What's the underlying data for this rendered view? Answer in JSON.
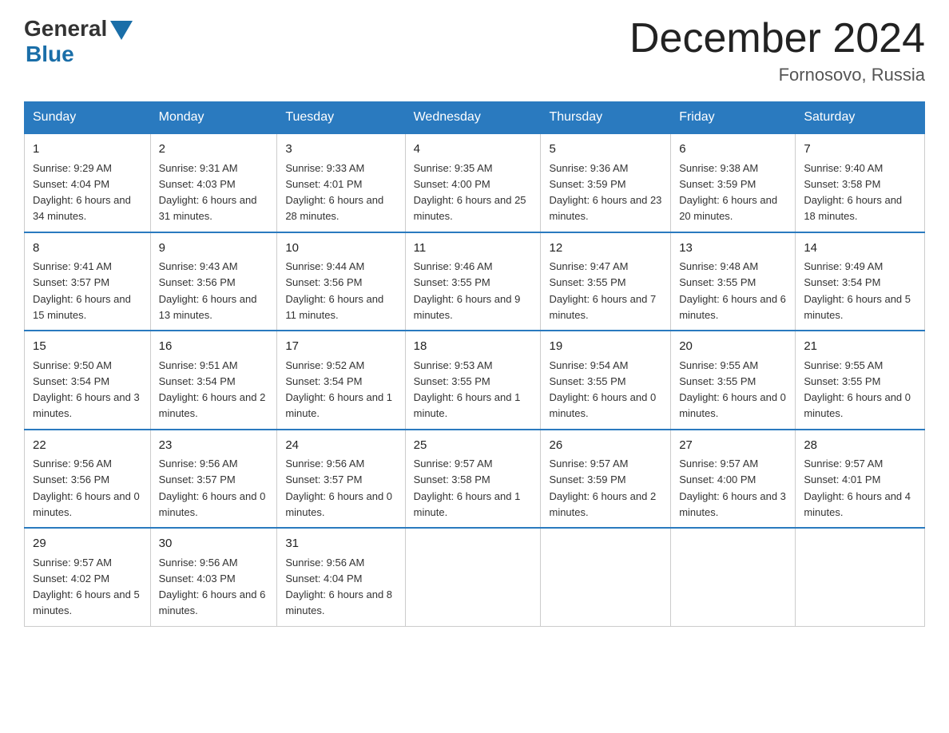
{
  "header": {
    "logo_general": "General",
    "logo_blue": "Blue",
    "main_title": "December 2024",
    "subtitle": "Fornosovo, Russia"
  },
  "days_of_week": [
    "Sunday",
    "Monday",
    "Tuesday",
    "Wednesday",
    "Thursday",
    "Friday",
    "Saturday"
  ],
  "weeks": [
    [
      {
        "day": 1,
        "sunrise": "9:29 AM",
        "sunset": "4:04 PM",
        "daylight": "6 hours and 34 minutes."
      },
      {
        "day": 2,
        "sunrise": "9:31 AM",
        "sunset": "4:03 PM",
        "daylight": "6 hours and 31 minutes."
      },
      {
        "day": 3,
        "sunrise": "9:33 AM",
        "sunset": "4:01 PM",
        "daylight": "6 hours and 28 minutes."
      },
      {
        "day": 4,
        "sunrise": "9:35 AM",
        "sunset": "4:00 PM",
        "daylight": "6 hours and 25 minutes."
      },
      {
        "day": 5,
        "sunrise": "9:36 AM",
        "sunset": "3:59 PM",
        "daylight": "6 hours and 23 minutes."
      },
      {
        "day": 6,
        "sunrise": "9:38 AM",
        "sunset": "3:59 PM",
        "daylight": "6 hours and 20 minutes."
      },
      {
        "day": 7,
        "sunrise": "9:40 AM",
        "sunset": "3:58 PM",
        "daylight": "6 hours and 18 minutes."
      }
    ],
    [
      {
        "day": 8,
        "sunrise": "9:41 AM",
        "sunset": "3:57 PM",
        "daylight": "6 hours and 15 minutes."
      },
      {
        "day": 9,
        "sunrise": "9:43 AM",
        "sunset": "3:56 PM",
        "daylight": "6 hours and 13 minutes."
      },
      {
        "day": 10,
        "sunrise": "9:44 AM",
        "sunset": "3:56 PM",
        "daylight": "6 hours and 11 minutes."
      },
      {
        "day": 11,
        "sunrise": "9:46 AM",
        "sunset": "3:55 PM",
        "daylight": "6 hours and 9 minutes."
      },
      {
        "day": 12,
        "sunrise": "9:47 AM",
        "sunset": "3:55 PM",
        "daylight": "6 hours and 7 minutes."
      },
      {
        "day": 13,
        "sunrise": "9:48 AM",
        "sunset": "3:55 PM",
        "daylight": "6 hours and 6 minutes."
      },
      {
        "day": 14,
        "sunrise": "9:49 AM",
        "sunset": "3:54 PM",
        "daylight": "6 hours and 5 minutes."
      }
    ],
    [
      {
        "day": 15,
        "sunrise": "9:50 AM",
        "sunset": "3:54 PM",
        "daylight": "6 hours and 3 minutes."
      },
      {
        "day": 16,
        "sunrise": "9:51 AM",
        "sunset": "3:54 PM",
        "daylight": "6 hours and 2 minutes."
      },
      {
        "day": 17,
        "sunrise": "9:52 AM",
        "sunset": "3:54 PM",
        "daylight": "6 hours and 1 minute."
      },
      {
        "day": 18,
        "sunrise": "9:53 AM",
        "sunset": "3:55 PM",
        "daylight": "6 hours and 1 minute."
      },
      {
        "day": 19,
        "sunrise": "9:54 AM",
        "sunset": "3:55 PM",
        "daylight": "6 hours and 0 minutes."
      },
      {
        "day": 20,
        "sunrise": "9:55 AM",
        "sunset": "3:55 PM",
        "daylight": "6 hours and 0 minutes."
      },
      {
        "day": 21,
        "sunrise": "9:55 AM",
        "sunset": "3:55 PM",
        "daylight": "6 hours and 0 minutes."
      }
    ],
    [
      {
        "day": 22,
        "sunrise": "9:56 AM",
        "sunset": "3:56 PM",
        "daylight": "6 hours and 0 minutes."
      },
      {
        "day": 23,
        "sunrise": "9:56 AM",
        "sunset": "3:57 PM",
        "daylight": "6 hours and 0 minutes."
      },
      {
        "day": 24,
        "sunrise": "9:56 AM",
        "sunset": "3:57 PM",
        "daylight": "6 hours and 0 minutes."
      },
      {
        "day": 25,
        "sunrise": "9:57 AM",
        "sunset": "3:58 PM",
        "daylight": "6 hours and 1 minute."
      },
      {
        "day": 26,
        "sunrise": "9:57 AM",
        "sunset": "3:59 PM",
        "daylight": "6 hours and 2 minutes."
      },
      {
        "day": 27,
        "sunrise": "9:57 AM",
        "sunset": "4:00 PM",
        "daylight": "6 hours and 3 minutes."
      },
      {
        "day": 28,
        "sunrise": "9:57 AM",
        "sunset": "4:01 PM",
        "daylight": "6 hours and 4 minutes."
      }
    ],
    [
      {
        "day": 29,
        "sunrise": "9:57 AM",
        "sunset": "4:02 PM",
        "daylight": "6 hours and 5 minutes."
      },
      {
        "day": 30,
        "sunrise": "9:56 AM",
        "sunset": "4:03 PM",
        "daylight": "6 hours and 6 minutes."
      },
      {
        "day": 31,
        "sunrise": "9:56 AM",
        "sunset": "4:04 PM",
        "daylight": "6 hours and 8 minutes."
      },
      null,
      null,
      null,
      null
    ]
  ]
}
